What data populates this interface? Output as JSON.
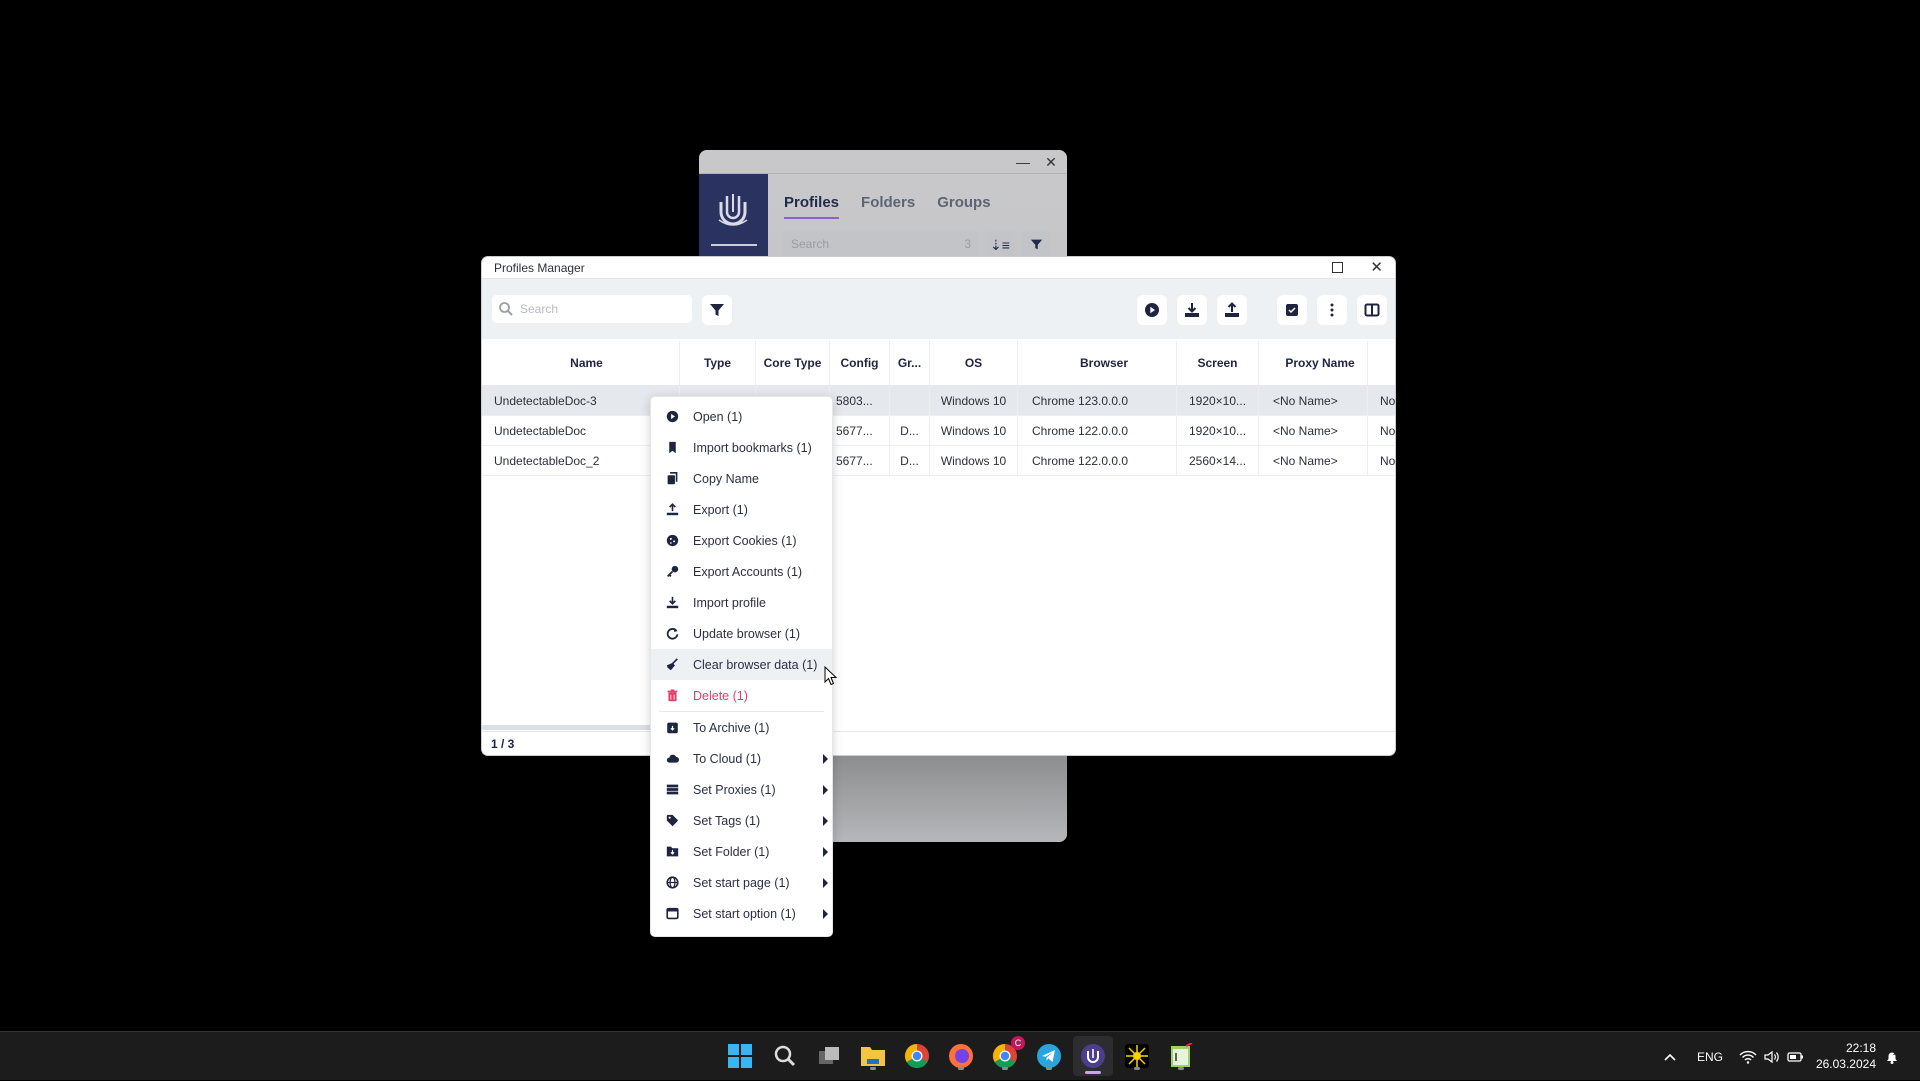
{
  "background_app": {
    "tabs": [
      {
        "label": "Profiles",
        "active": true
      },
      {
        "label": "Folders",
        "active": false
      },
      {
        "label": "Groups",
        "active": false
      }
    ],
    "search_placeholder": "Search",
    "search_count": "3",
    "accent_color": "#8a63c7",
    "sidebar_color": "#2a3360"
  },
  "profiles_manager": {
    "title": "Profiles Manager",
    "search_placeholder": "Search",
    "toolbar_icons": [
      "filter-icon",
      "play-icon",
      "download-icon",
      "upload-icon",
      "select-all-icon",
      "more-vertical-icon",
      "columns-icon"
    ],
    "columns": [
      "Name",
      "Type",
      "Core Type",
      "Config",
      "Gr...",
      "OS",
      "Browser",
      "Screen",
      "Proxy Name",
      ""
    ],
    "rows": [
      {
        "name": "UndetectableDoc-3",
        "type": "",
        "core_type": "",
        "config": "5803...",
        "group": "",
        "os": "Windows 10",
        "browser": "Chrome 123.0.0.0",
        "screen": "1920×10...",
        "proxy": "<No Name>",
        "next": "No",
        "selected": true
      },
      {
        "name": "UndetectableDoc",
        "type": "",
        "core_type": "",
        "config": "5677...",
        "group": "D...",
        "os": "Windows 10",
        "browser": "Chrome 122.0.0.0",
        "screen": "1920×10...",
        "proxy": "<No Name>",
        "next": "No",
        "selected": false
      },
      {
        "name": "UndetectableDoc_2",
        "type": "",
        "core_type": "",
        "config": "5677...",
        "group": "D...",
        "os": "Windows 10",
        "browser": "Chrome 122.0.0.0",
        "screen": "2560×14...",
        "proxy": "<No Name>",
        "next": "No",
        "selected": false
      }
    ],
    "footer_count": "1 / 3"
  },
  "context_menu": {
    "items": [
      {
        "label": "Open (1)",
        "icon": "play-circle-icon"
      },
      {
        "label": "Import bookmarks (1)",
        "icon": "bookmark-icon"
      },
      {
        "label": "Copy Name",
        "icon": "copy-icon"
      },
      {
        "label": "Export (1)",
        "icon": "upload-icon"
      },
      {
        "label": "Export Cookies (1)",
        "icon": "cookie-icon"
      },
      {
        "label": "Export Accounts (1)",
        "icon": "key-icon"
      },
      {
        "label": "Import profile",
        "icon": "download-icon"
      },
      {
        "label": "Update browser (1)",
        "icon": "refresh-icon"
      },
      {
        "label": "Clear browser data (1)",
        "icon": "broom-icon",
        "hover": true
      },
      {
        "label": "Delete (1)",
        "icon": "trash-icon",
        "danger": true
      },
      {
        "label": "To Archive (1)",
        "icon": "archive-icon",
        "separator_before": true
      },
      {
        "label": "To Cloud (1)",
        "icon": "cloud-icon",
        "submenu": true
      },
      {
        "label": "Set Proxies (1)",
        "icon": "server-icon",
        "submenu": true
      },
      {
        "label": "Set Tags (1)",
        "icon": "tag-icon",
        "submenu": true
      },
      {
        "label": "Set Folder (1)",
        "icon": "folder-icon",
        "submenu": true
      },
      {
        "label": "Set start page (1)",
        "icon": "globe-icon",
        "submenu": true
      },
      {
        "label": "Set start option (1)",
        "icon": "window-icon",
        "submenu": true
      }
    ],
    "danger_color": "#e0406b"
  },
  "taskbar": {
    "apps": [
      "start",
      "search",
      "task-view",
      "file-explorer",
      "chrome",
      "firefox",
      "chrome-profile",
      "telegram",
      "undetectable",
      "app-sun",
      "notepad-plus"
    ],
    "chrome_profile_badge": "C",
    "language": "ENG",
    "time": "22:18",
    "date": "26.03.2024"
  }
}
